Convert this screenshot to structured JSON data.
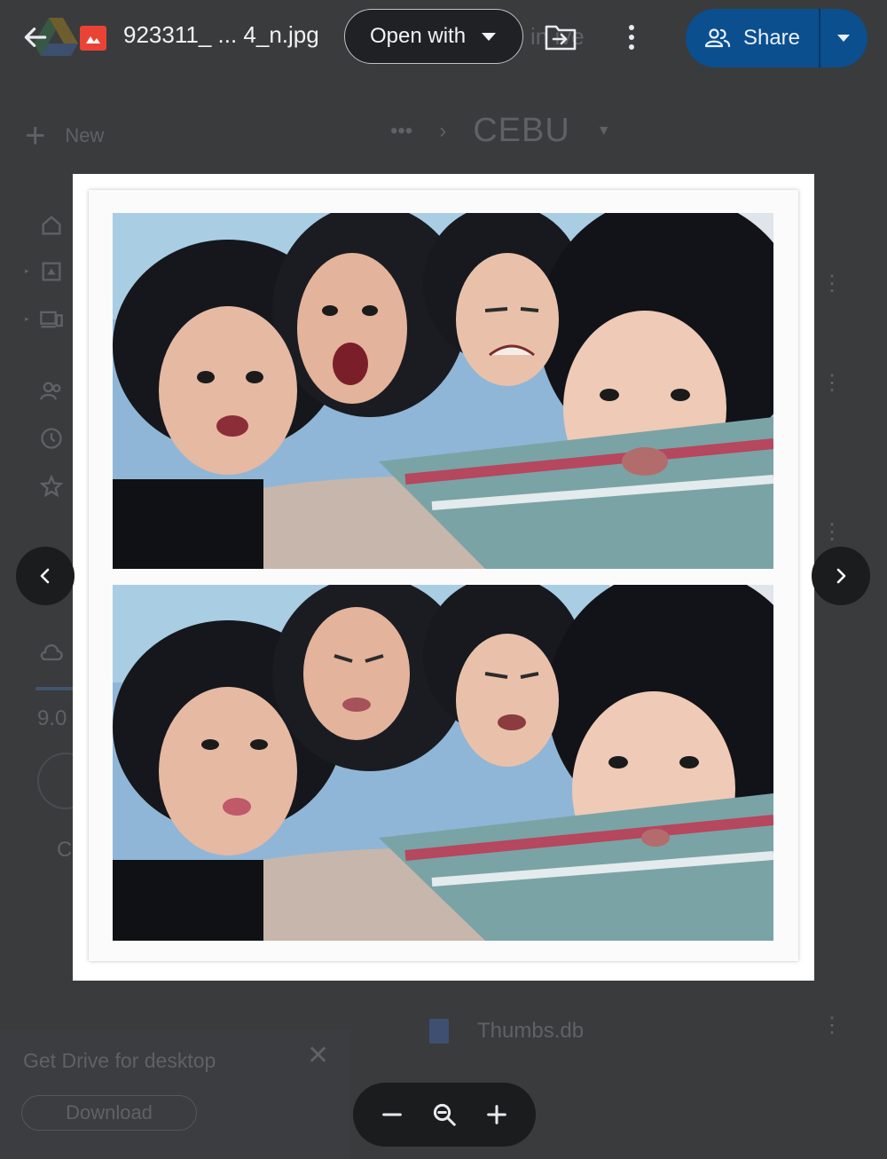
{
  "topbar": {
    "filename": "923311_ ... 4_n.jpg",
    "open_with": "Open with",
    "ghost_text": "in  ive",
    "share_label": "Share"
  },
  "background": {
    "new_label": "New",
    "breadcrumb_more": "•••",
    "breadcrumb_sep": "›",
    "folder": "CEBU",
    "storage_text": "9.0",
    "c_letter": "C",
    "file_name": "Thumbs.db",
    "desktop_promo": "Get Drive for desktop",
    "download_label": "Download"
  },
  "icons": {
    "back": "arrow-left",
    "image": "image-file",
    "move": "move-to-folder",
    "more": "more-vert",
    "share": "people",
    "prev": "chevron-left",
    "next": "chevron-right",
    "zoom_out": "minus",
    "zoom": "magnifier",
    "zoom_in": "plus"
  },
  "colors": {
    "share_bg": "#0b4f8f",
    "backdrop": "#3a3b3d",
    "image_icon": "#ea4335"
  }
}
